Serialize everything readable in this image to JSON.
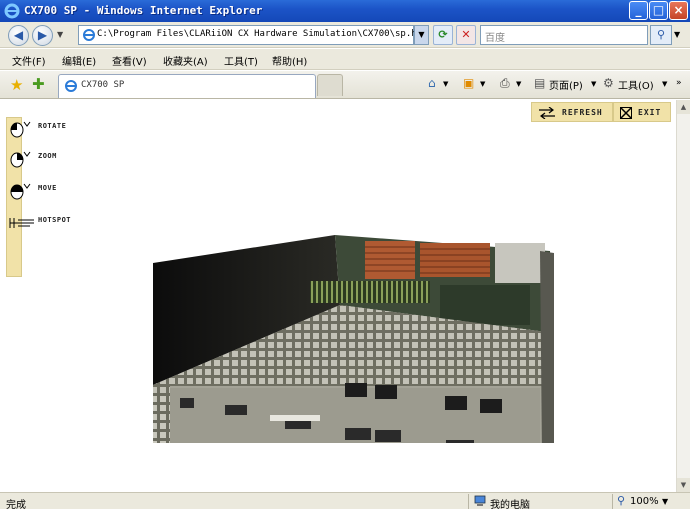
{
  "window": {
    "title": "CX700 SP - Windows Internet Explorer",
    "minimize": "_",
    "maximize": "□",
    "close": "×"
  },
  "address": {
    "url": "C:\\Program Files\\CLARiiON CX Hardware Simulation\\CX700\\sp.htm",
    "search_placeholder": "百度"
  },
  "menu": {
    "items": [
      "文件(F)",
      "编辑(E)",
      "查看(V)",
      "收藏夹(A)",
      "工具(T)",
      "帮助(H)"
    ]
  },
  "tab": {
    "label": "CX700 SP"
  },
  "commands": {
    "page": "页面(P)",
    "tools": "工具(O)"
  },
  "tools": {
    "rotate": "ROTATE",
    "zoom": "ZOOM",
    "move": "MOVE",
    "hotspot": "HOTSPOT"
  },
  "buttons": {
    "refresh": "REFRESH",
    "exit": "EXIT"
  },
  "status": {
    "text": "完成",
    "zone": "我的电脑",
    "zoom": "100%"
  },
  "colors": {
    "titlebar": "#1c54c7",
    "panel": "#f1e2a8",
    "chrome": "#ebe9dd"
  }
}
